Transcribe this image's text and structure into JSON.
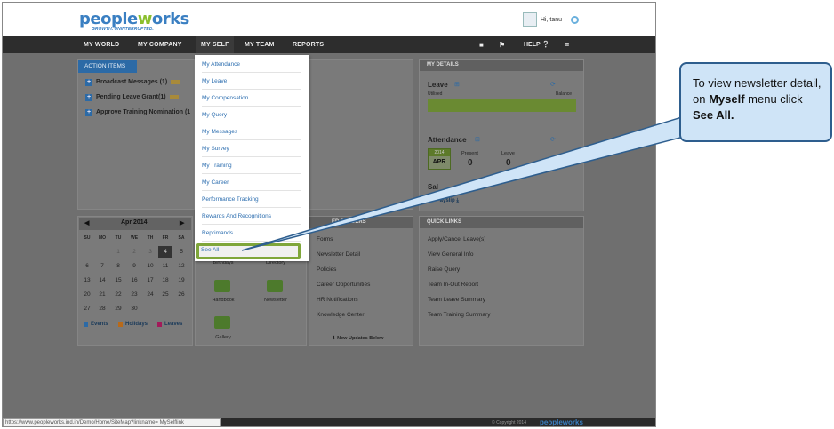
{
  "header": {
    "logo_text_a": "pe",
    "logo_text_b": "ople",
    "logo_text_c": "w",
    "logo_text_d": "orks",
    "tagline": "GROWTH. UNINTERRUPTED.",
    "greeting": "Hi, tanu"
  },
  "nav": {
    "items": [
      "MY WORLD",
      "MY COMPANY",
      "MY SELF",
      "MY TEAM",
      "REPORTS"
    ],
    "help": "HELP"
  },
  "action_items": {
    "tab": "ACTION ITEMS",
    "rows": [
      "Broadcast Messages (1)",
      "Pending Leave Grant(1)",
      "Approve Training Nomination (1"
    ]
  },
  "myself_menu": {
    "items": [
      "My Attendance",
      "My Leave",
      "My Compensation",
      "My Query",
      "My Messages",
      "My Survey",
      "My Training",
      "My Career",
      "Performance Tracking",
      "Rewards And Recognitions",
      "Reprimands"
    ],
    "see_all": "See All"
  },
  "calendar": {
    "month": "Apr 2014",
    "dow": [
      "SU",
      "MO",
      "TU",
      "WE",
      "TH",
      "FR",
      "SA"
    ],
    "weeks": [
      [
        "",
        "",
        "1",
        "2",
        "3",
        "4",
        "5"
      ],
      [
        "6",
        "7",
        "8",
        "9",
        "10",
        "11",
        "12"
      ],
      [
        "13",
        "14",
        "15",
        "16",
        "17",
        "18",
        "19"
      ],
      [
        "20",
        "21",
        "22",
        "23",
        "24",
        "25",
        "26"
      ],
      [
        "27",
        "28",
        "29",
        "30",
        "",
        "",
        ""
      ]
    ],
    "legend": [
      "Events",
      "Holidays",
      "Leaves"
    ]
  },
  "shortcuts": {
    "labels": [
      "Birthdays",
      "Directory",
      "Handbook",
      "Newsletter",
      "Gallery"
    ]
  },
  "folders": {
    "title": "ED FOLDERS",
    "items": [
      "Forms",
      "Newsletter Detail",
      "Policies",
      "Career Opportunities",
      "HR Notifications",
      "Knowledge Center"
    ],
    "footer": "New Updates Below"
  },
  "my_details": {
    "title": "MY DETAILS",
    "leave_title": "Leave",
    "availed": "Utilised",
    "balance": "Balance",
    "attendance_title": "Attendance",
    "att_year": "2014",
    "att_month": "APR",
    "present_label": "Present",
    "present_value": "0",
    "leave_label": "Leave",
    "leave_value": "0",
    "salary_title": "Sal",
    "no_payslip": "No Payslip"
  },
  "quick_links": {
    "title": "QUICK LINKS",
    "items": [
      "Apply/Cancel Leave(s)",
      "View General Info",
      "Raise Query",
      "Team In-Out Report",
      "Team Leave Summary",
      "Team Training Summary"
    ]
  },
  "status": {
    "url": "https://www.peopleworks.ind.in/Demo/Home/SiteMap?linkname= MySelflink",
    "copyright": "© Copyright 2014",
    "foot_logo": "peopleworks"
  },
  "callout": {
    "line1": "To view newsletter detail, on ",
    "bold1": "Myself",
    "line2": " menu click ",
    "bold2": "See All."
  },
  "colors": {
    "accent": "#2c6aa6",
    "highlight": "#7fa63a",
    "callout_bg": "#cfe4f7"
  }
}
